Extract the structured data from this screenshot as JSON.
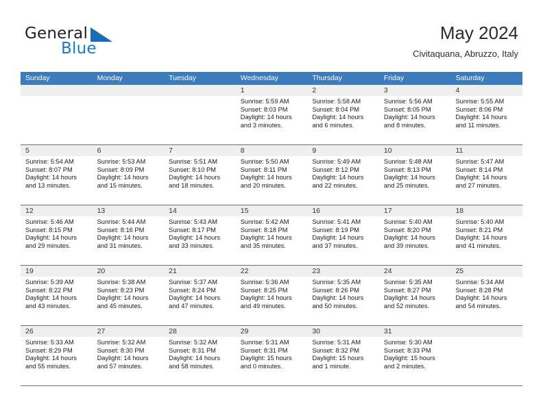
{
  "brand": {
    "name_part1": "General",
    "name_part2": "Blue",
    "accent_color": "#1c76c4"
  },
  "header": {
    "title": "May 2024",
    "location": "Civitaquana, Abruzzo, Italy"
  },
  "calendar": {
    "header_bg": "#3a7cbe",
    "day_headers": [
      "Sunday",
      "Monday",
      "Tuesday",
      "Wednesday",
      "Thursday",
      "Friday",
      "Saturday"
    ],
    "labels": {
      "sunrise": "Sunrise:",
      "sunset": "Sunset:",
      "daylight": "Daylight:"
    },
    "weeks": [
      [
        {
          "day": "",
          "sunrise": "",
          "sunset": "",
          "daylight_line1": "",
          "daylight_line2": ""
        },
        {
          "day": "",
          "sunrise": "",
          "sunset": "",
          "daylight_line1": "",
          "daylight_line2": ""
        },
        {
          "day": "",
          "sunrise": "",
          "sunset": "",
          "daylight_line1": "",
          "daylight_line2": ""
        },
        {
          "day": "1",
          "sunrise": "Sunrise: 5:59 AM",
          "sunset": "Sunset: 8:03 PM",
          "daylight_line1": "Daylight: 14 hours",
          "daylight_line2": "and 3 minutes."
        },
        {
          "day": "2",
          "sunrise": "Sunrise: 5:58 AM",
          "sunset": "Sunset: 8:04 PM",
          "daylight_line1": "Daylight: 14 hours",
          "daylight_line2": "and 6 minutes."
        },
        {
          "day": "3",
          "sunrise": "Sunrise: 5:56 AM",
          "sunset": "Sunset: 8:05 PM",
          "daylight_line1": "Daylight: 14 hours",
          "daylight_line2": "and 8 minutes."
        },
        {
          "day": "4",
          "sunrise": "Sunrise: 5:55 AM",
          "sunset": "Sunset: 8:06 PM",
          "daylight_line1": "Daylight: 14 hours",
          "daylight_line2": "and 11 minutes."
        }
      ],
      [
        {
          "day": "5",
          "sunrise": "Sunrise: 5:54 AM",
          "sunset": "Sunset: 8:07 PM",
          "daylight_line1": "Daylight: 14 hours",
          "daylight_line2": "and 13 minutes."
        },
        {
          "day": "6",
          "sunrise": "Sunrise: 5:53 AM",
          "sunset": "Sunset: 8:09 PM",
          "daylight_line1": "Daylight: 14 hours",
          "daylight_line2": "and 15 minutes."
        },
        {
          "day": "7",
          "sunrise": "Sunrise: 5:51 AM",
          "sunset": "Sunset: 8:10 PM",
          "daylight_line1": "Daylight: 14 hours",
          "daylight_line2": "and 18 minutes."
        },
        {
          "day": "8",
          "sunrise": "Sunrise: 5:50 AM",
          "sunset": "Sunset: 8:11 PM",
          "daylight_line1": "Daylight: 14 hours",
          "daylight_line2": "and 20 minutes."
        },
        {
          "day": "9",
          "sunrise": "Sunrise: 5:49 AM",
          "sunset": "Sunset: 8:12 PM",
          "daylight_line1": "Daylight: 14 hours",
          "daylight_line2": "and 22 minutes."
        },
        {
          "day": "10",
          "sunrise": "Sunrise: 5:48 AM",
          "sunset": "Sunset: 8:13 PM",
          "daylight_line1": "Daylight: 14 hours",
          "daylight_line2": "and 25 minutes."
        },
        {
          "day": "11",
          "sunrise": "Sunrise: 5:47 AM",
          "sunset": "Sunset: 8:14 PM",
          "daylight_line1": "Daylight: 14 hours",
          "daylight_line2": "and 27 minutes."
        }
      ],
      [
        {
          "day": "12",
          "sunrise": "Sunrise: 5:46 AM",
          "sunset": "Sunset: 8:15 PM",
          "daylight_line1": "Daylight: 14 hours",
          "daylight_line2": "and 29 minutes."
        },
        {
          "day": "13",
          "sunrise": "Sunrise: 5:44 AM",
          "sunset": "Sunset: 8:16 PM",
          "daylight_line1": "Daylight: 14 hours",
          "daylight_line2": "and 31 minutes."
        },
        {
          "day": "14",
          "sunrise": "Sunrise: 5:43 AM",
          "sunset": "Sunset: 8:17 PM",
          "daylight_line1": "Daylight: 14 hours",
          "daylight_line2": "and 33 minutes."
        },
        {
          "day": "15",
          "sunrise": "Sunrise: 5:42 AM",
          "sunset": "Sunset: 8:18 PM",
          "daylight_line1": "Daylight: 14 hours",
          "daylight_line2": "and 35 minutes."
        },
        {
          "day": "16",
          "sunrise": "Sunrise: 5:41 AM",
          "sunset": "Sunset: 8:19 PM",
          "daylight_line1": "Daylight: 14 hours",
          "daylight_line2": "and 37 minutes."
        },
        {
          "day": "17",
          "sunrise": "Sunrise: 5:40 AM",
          "sunset": "Sunset: 8:20 PM",
          "daylight_line1": "Daylight: 14 hours",
          "daylight_line2": "and 39 minutes."
        },
        {
          "day": "18",
          "sunrise": "Sunrise: 5:40 AM",
          "sunset": "Sunset: 8:21 PM",
          "daylight_line1": "Daylight: 14 hours",
          "daylight_line2": "and 41 minutes."
        }
      ],
      [
        {
          "day": "19",
          "sunrise": "Sunrise: 5:39 AM",
          "sunset": "Sunset: 8:22 PM",
          "daylight_line1": "Daylight: 14 hours",
          "daylight_line2": "and 43 minutes."
        },
        {
          "day": "20",
          "sunrise": "Sunrise: 5:38 AM",
          "sunset": "Sunset: 8:23 PM",
          "daylight_line1": "Daylight: 14 hours",
          "daylight_line2": "and 45 minutes."
        },
        {
          "day": "21",
          "sunrise": "Sunrise: 5:37 AM",
          "sunset": "Sunset: 8:24 PM",
          "daylight_line1": "Daylight: 14 hours",
          "daylight_line2": "and 47 minutes."
        },
        {
          "day": "22",
          "sunrise": "Sunrise: 5:36 AM",
          "sunset": "Sunset: 8:25 PM",
          "daylight_line1": "Daylight: 14 hours",
          "daylight_line2": "and 49 minutes."
        },
        {
          "day": "23",
          "sunrise": "Sunrise: 5:35 AM",
          "sunset": "Sunset: 8:26 PM",
          "daylight_line1": "Daylight: 14 hours",
          "daylight_line2": "and 50 minutes."
        },
        {
          "day": "24",
          "sunrise": "Sunrise: 5:35 AM",
          "sunset": "Sunset: 8:27 PM",
          "daylight_line1": "Daylight: 14 hours",
          "daylight_line2": "and 52 minutes."
        },
        {
          "day": "25",
          "sunrise": "Sunrise: 5:34 AM",
          "sunset": "Sunset: 8:28 PM",
          "daylight_line1": "Daylight: 14 hours",
          "daylight_line2": "and 54 minutes."
        }
      ],
      [
        {
          "day": "26",
          "sunrise": "Sunrise: 5:33 AM",
          "sunset": "Sunset: 8:29 PM",
          "daylight_line1": "Daylight: 14 hours",
          "daylight_line2": "and 55 minutes."
        },
        {
          "day": "27",
          "sunrise": "Sunrise: 5:32 AM",
          "sunset": "Sunset: 8:30 PM",
          "daylight_line1": "Daylight: 14 hours",
          "daylight_line2": "and 57 minutes."
        },
        {
          "day": "28",
          "sunrise": "Sunrise: 5:32 AM",
          "sunset": "Sunset: 8:31 PM",
          "daylight_line1": "Daylight: 14 hours",
          "daylight_line2": "and 58 minutes."
        },
        {
          "day": "29",
          "sunrise": "Sunrise: 5:31 AM",
          "sunset": "Sunset: 8:31 PM",
          "daylight_line1": "Daylight: 15 hours",
          "daylight_line2": "and 0 minutes."
        },
        {
          "day": "30",
          "sunrise": "Sunrise: 5:31 AM",
          "sunset": "Sunset: 8:32 PM",
          "daylight_line1": "Daylight: 15 hours",
          "daylight_line2": "and 1 minute."
        },
        {
          "day": "31",
          "sunrise": "Sunrise: 5:30 AM",
          "sunset": "Sunset: 8:33 PM",
          "daylight_line1": "Daylight: 15 hours",
          "daylight_line2": "and 2 minutes."
        },
        {
          "day": "",
          "sunrise": "",
          "sunset": "",
          "daylight_line1": "",
          "daylight_line2": ""
        }
      ]
    ]
  }
}
